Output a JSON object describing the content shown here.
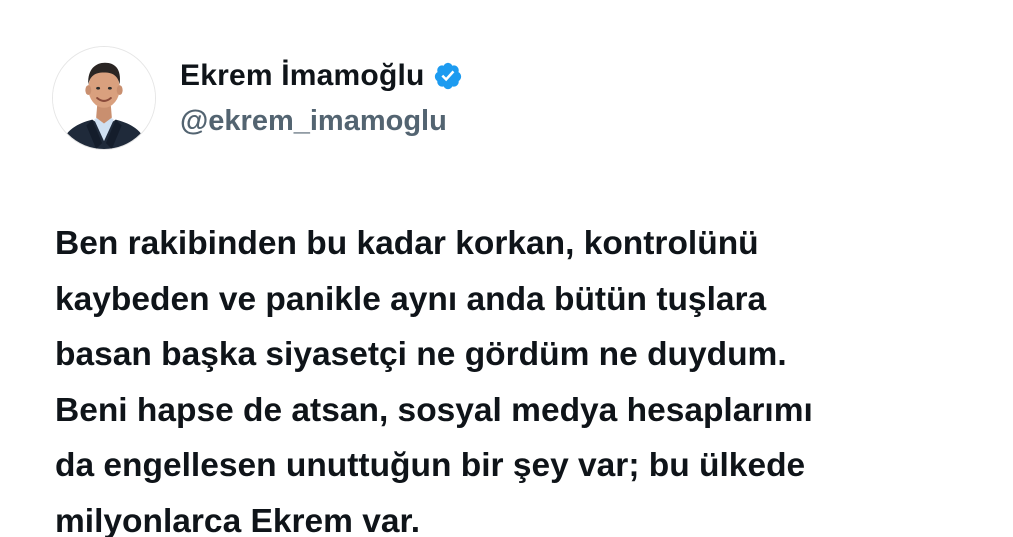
{
  "author": {
    "display_name": "Ekrem İmamoğlu",
    "handle": "@ekrem_imamoglu",
    "verified": true,
    "avatar_icon": "profile-photo",
    "verified_icon": "verified-badge-icon"
  },
  "tweet": {
    "lines": [
      "Ben rakibinden bu kadar korkan, kontrolünü",
      "kaybeden ve panikle aynı anda bütün tuşlara",
      "basan başka siyasetçi ne gördüm ne duydum.",
      "Beni hapse de atsan, sosyal medya hesaplarımı",
      "da engellesen unuttuğun bir şey var; bu ülkede",
      "milyonlarca Ekrem var."
    ]
  },
  "colors": {
    "text": "#0f1419",
    "secondary_text": "#536471",
    "verified": "#1d9bf0",
    "background": "#ffffff"
  }
}
